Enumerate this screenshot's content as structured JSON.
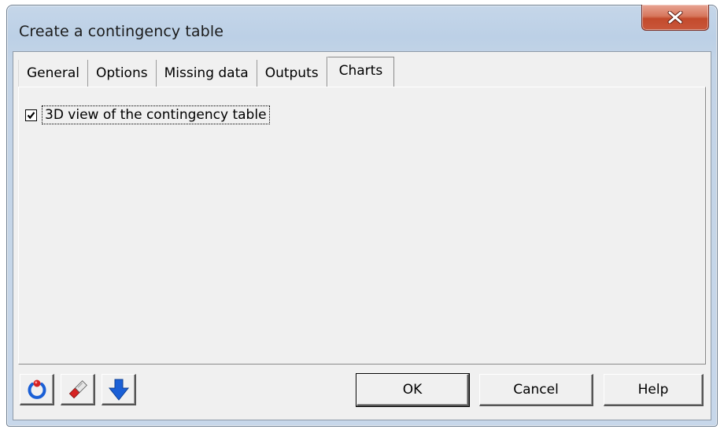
{
  "window": {
    "title": "Create a contingency table"
  },
  "tabs": [
    {
      "label": "General",
      "active": false
    },
    {
      "label": "Options",
      "active": false
    },
    {
      "label": "Missing data",
      "active": false
    },
    {
      "label": "Outputs",
      "active": false
    },
    {
      "label": "Charts",
      "active": true
    }
  ],
  "charts_tab": {
    "view3d_checkbox": {
      "label": "3D view of the contingency table",
      "checked": true
    }
  },
  "buttons": {
    "ok": "OK",
    "cancel": "Cancel",
    "help": "Help"
  },
  "icons": {
    "reset": "reset-icon",
    "eraser": "eraser-icon",
    "down_arrow": "down-arrow-icon",
    "close": "close-icon"
  },
  "colors": {
    "close_button": "#c94f32",
    "icon_blue": "#1a5fd6",
    "icon_red": "#d62222"
  }
}
